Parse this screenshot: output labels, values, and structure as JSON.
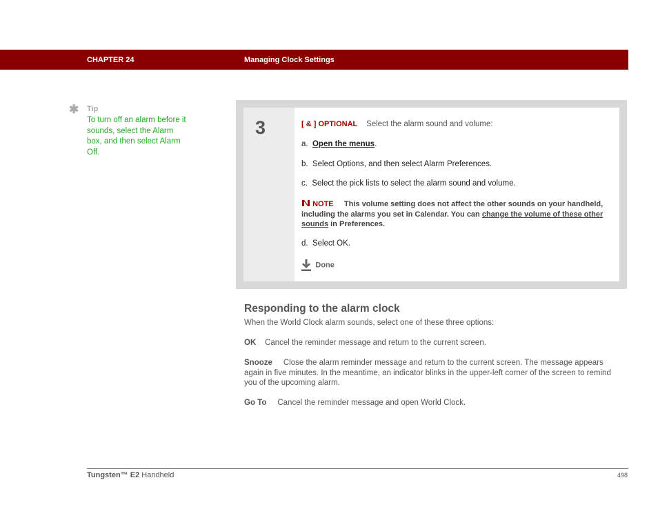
{
  "header": {
    "chapter": "CHAPTER 24",
    "title": "Managing Clock Settings",
    "bg_color": "#8a0000"
  },
  "tip": {
    "icon": "asterisk-icon",
    "label": "Tip",
    "text": "To turn off an alarm before it sounds, select the Alarm box, and then select Alarm Off."
  },
  "step": {
    "number": "3",
    "optional_marker": "[ & ]  OPTIONAL",
    "intro": "Select the alarm sound and volume:",
    "items": [
      {
        "prefix": "a.",
        "link": "Open the menus",
        "suffix": "."
      },
      {
        "prefix": "b.",
        "text": "Select Options, and then select Alarm Preferences."
      },
      {
        "prefix": "c.",
        "text": "Select the pick lists to select the alarm sound and volume."
      },
      {
        "prefix": "d.",
        "text": "Select OK."
      }
    ],
    "note": {
      "label": "NOTE",
      "text_before": "This volume setting does not affect the other sounds on your handheld, including the alarms you set in Calendar. You can ",
      "link": "change the volume of these other sounds",
      "text_after": " in Preferences."
    },
    "done_label": "Done"
  },
  "section": {
    "heading": "Responding to the alarm clock",
    "intro": "When the World Clock alarm sounds, select one of these three options:",
    "options": [
      {
        "term": "OK",
        "desc": "Cancel the reminder message and return to the current screen."
      },
      {
        "term": "Snooze",
        "desc": "Close the alarm reminder message and return to the current screen. The message appears again in five minutes. In the meantime, an indicator blinks in the upper-left corner of the screen to remind you of the upcoming alarm."
      },
      {
        "term": "Go To",
        "desc": "Cancel the reminder message and open World Clock."
      }
    ]
  },
  "footer": {
    "product_bold": "Tungsten™ E2",
    "product_rest": " Handheld",
    "page": "498"
  }
}
